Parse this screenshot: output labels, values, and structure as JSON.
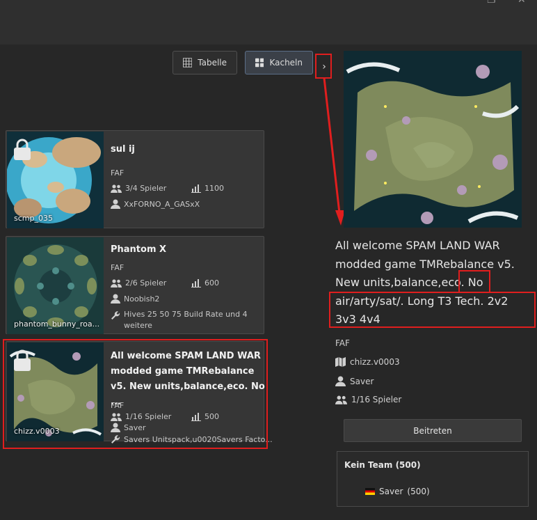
{
  "view": {
    "table_label": "Tabelle",
    "tiles_label": "Kacheln",
    "collapse_glyph": "›"
  },
  "games": [
    {
      "title": "sul ij",
      "featured_mod": "FAF",
      "players": "3/4 Spieler",
      "rating": "1100",
      "host": "XxFORNO_A_GASxX",
      "map": "scmp_035",
      "locked": true
    },
    {
      "title": "Phantom X",
      "featured_mod": "FAF",
      "players": "2/6 Spieler",
      "rating": "600",
      "host": "Noobish2",
      "mods": "Hives 25 50 75 Build Rate und 4 weitere",
      "map": "phantom_bunny_roa...",
      "locked": false
    },
    {
      "title": "All welcome SPAM LAND WAR modded game TMRebalance v5. New units,balance,eco. No ...",
      "featured_mod": "FAF",
      "players": "1/16 Spieler",
      "rating": "500",
      "host": "Saver",
      "mods": "Savers Unitspack,u0020Savers Facto...",
      "map": "chizz.v0003",
      "locked": true
    }
  ],
  "details": {
    "description": "All welcome SPAM LAND WAR modded game TMRebalance v5. New units,balance,eco. No air/arty/sat/. Long T3 Tech. 2v2 3v3 4v4",
    "featured_mod": "FAF",
    "map": "chizz.v0003",
    "host": "Saver",
    "players": "1/16 Spieler",
    "join_label": "Beitreten",
    "team": {
      "name": "Kein Team (500)",
      "player_name": "Saver",
      "player_rating": "(500)",
      "flag": "germany-flag"
    }
  },
  "icons": {
    "table": "grid-icon",
    "tiles": "tiles-icon",
    "players": "people-icon",
    "rating": "bar-chart-icon",
    "host": "person-icon",
    "mods": "wrench-icon",
    "map": "map-icon",
    "lock": "lock-icon"
  },
  "colors": {
    "highlight_red": "#e01e1e",
    "active_button": "#3b4048"
  }
}
